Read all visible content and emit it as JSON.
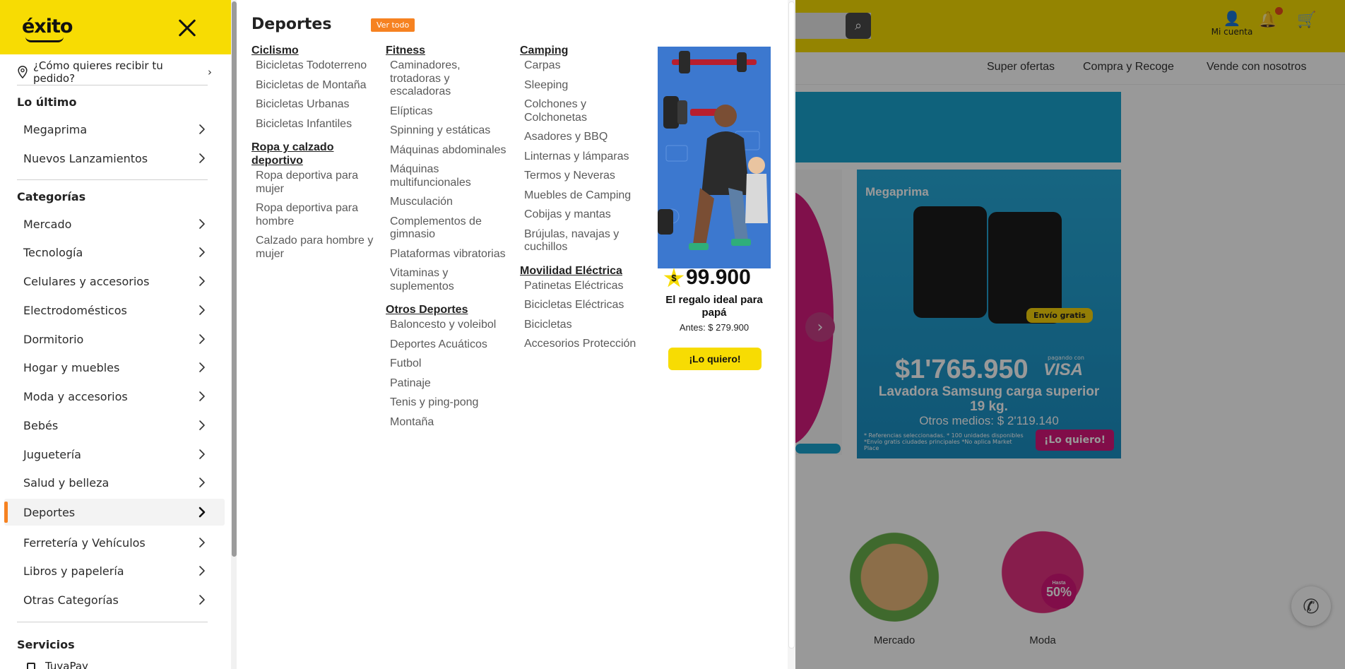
{
  "background": {
    "account_label": "Mi cuenta",
    "nav_links": [
      "Super ofertas",
      "Compra y Recoge",
      "Vende con nosotros"
    ],
    "promo": {
      "brand": "Megaprima",
      "shipping_badge": "Envío gratis",
      "price": "$1'765.950",
      "payment_note": "pagando con",
      "card": "VISA",
      "description": "Lavadora Samsung carga superior 19 kg.",
      "other_means": "Otros medios: $ 2'119.140",
      "cta": "¡Lo quiero!",
      "fine_print": "* Referencias seleccionadas. * 100 unidades disponibles *Envío gratis ciudades principales *No aplica Market Place"
    },
    "categories": [
      "Mercado",
      "Moda"
    ],
    "moda_badge_top": "Hasta",
    "moda_badge": "50%"
  },
  "drawer": {
    "logo": "éxito",
    "delivery_prompt": "¿Cómo quieres recibir tu pedido?",
    "latest_title": "Lo último",
    "latest_items": [
      "Megaprima",
      "Nuevos Lanzamientos"
    ],
    "categories_title": "Categorías",
    "categories": [
      "Mercado",
      "Tecnología",
      "Celulares y accesorios",
      "Electrodomésticos",
      "Dormitorio",
      "Hogar y muebles",
      "Moda y accesorios",
      "Bebés",
      "Juguetería",
      "Salud y belleza",
      "Deportes",
      "Ferretería y Vehículos",
      "Libros y papelería",
      "Otras Categorías"
    ],
    "active_category": "Deportes",
    "services_title": "Servicios",
    "services_first": "TuyaPay"
  },
  "mega": {
    "title": "Deportes",
    "see_all": "Ver todo",
    "columns": [
      [
        {
          "title": "Ciclismo",
          "items": [
            "Bicicletas Todoterreno",
            "Bicicletas de Montaña",
            "Bicicletas Urbanas",
            "Bicicletas Infantiles"
          ]
        },
        {
          "title": "Ropa y calzado deportivo",
          "items": [
            "Ropa deportiva para mujer",
            "Ropa deportiva para hombre",
            "Calzado para hombre y mujer"
          ]
        }
      ],
      [
        {
          "title": "Fitness",
          "items": [
            "Caminadores, trotadoras y escaladoras",
            "Elípticas",
            "Spinning y estáticas",
            "Máquinas abdominales",
            "Máquinas multifuncionales",
            "Musculación",
            "Complementos de gimnasio",
            "Plataformas vibratorias",
            "Vitaminas y suplementos"
          ]
        },
        {
          "title": "Otros Deportes",
          "items": [
            "Baloncesto y voleibol",
            "Deportes Acuáticos",
            "Futbol",
            "Patinaje",
            "Tenis y ping-pong",
            "Montaña"
          ]
        }
      ],
      [
        {
          "title": "Camping",
          "items": [
            "Carpas",
            "Sleeping",
            "Colchones y Colchonetas",
            "Asadores y BBQ",
            "Linternas y lámparas",
            "Termos y Neveras",
            "Muebles de Camping",
            "Cobijas y mantas",
            "Brújulas, navajas y cuchillos"
          ]
        },
        {
          "title": "Movilidad Eléctrica",
          "items": [
            "Patinetas Eléctricas",
            "Bicicletas Eléctricas",
            "Bicicletas",
            "Accesorios Protección"
          ]
        }
      ]
    ]
  },
  "ad": {
    "currency": "$",
    "price": "99.900",
    "text": "El regalo ideal para papá",
    "before": "Antes: $ 279.900",
    "cta": "¡Lo quiero!"
  },
  "colors": {
    "brand_yellow": "#f7dc03",
    "accent_orange": "#f68221",
    "promo_blue": "#1aa3cf",
    "promo_pink": "#d8177a"
  }
}
